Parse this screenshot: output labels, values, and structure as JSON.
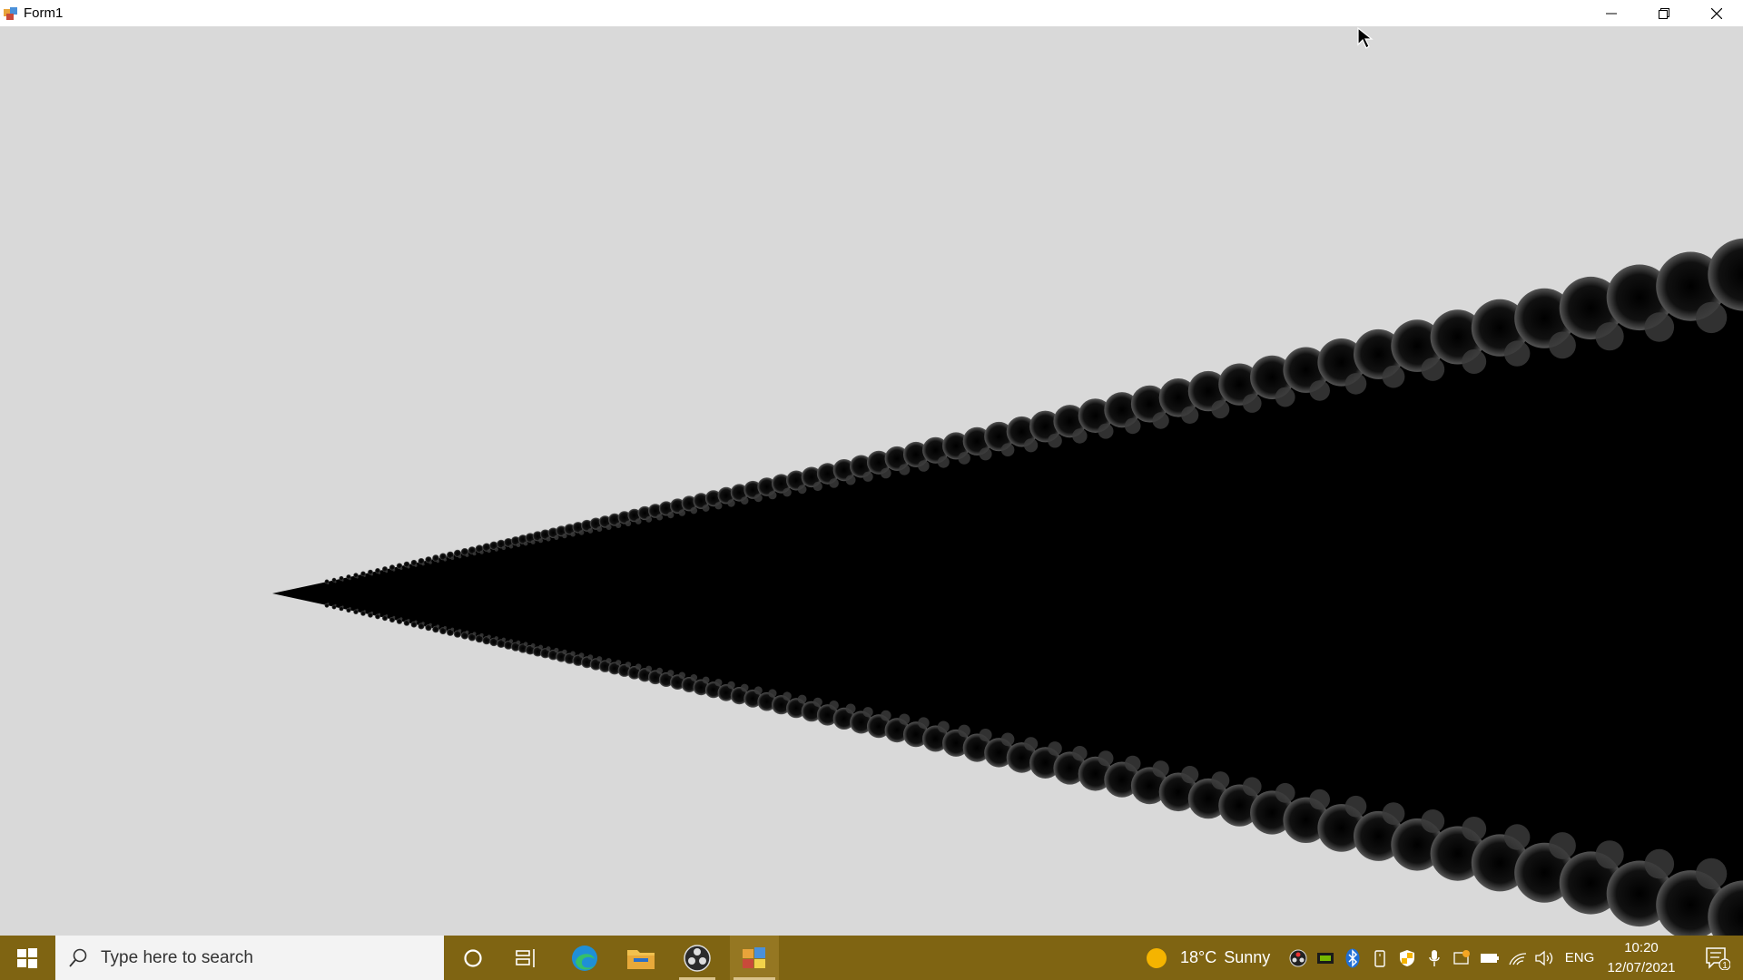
{
  "window": {
    "title": "Form1"
  },
  "taskbar": {
    "search_placeholder": "Type here to search",
    "weather": {
      "temp": "18°C",
      "condition": "Sunny"
    },
    "language": "ENG",
    "clock": {
      "time": "10:20",
      "date": "12/07/2021"
    },
    "notification_count": "1"
  }
}
